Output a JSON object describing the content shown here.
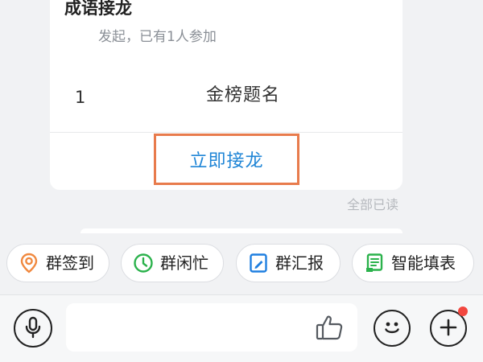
{
  "card": {
    "title": "成语接龙",
    "subtitle": "发起，已有1人参加",
    "entries": [
      {
        "index": "1",
        "text": "金榜题名"
      }
    ],
    "join_label": "立即接龙"
  },
  "read_status": "全部已读",
  "quick_actions": [
    {
      "label": "群签到",
      "icon": "location-pin-icon",
      "color": "#f0883e"
    },
    {
      "label": "群闲忙",
      "icon": "clock-icon",
      "color": "#2bb24c"
    },
    {
      "label": "群汇报",
      "icon": "report-edit-icon",
      "color": "#1f7fe0"
    },
    {
      "label": "智能填表",
      "icon": "form-table-icon",
      "color": "#2bb24c"
    }
  ],
  "input_bar": {
    "icons": [
      "microphone-icon",
      "thumbs-up-icon",
      "emoji-icon",
      "plus-icon"
    ],
    "badge_color": "#f2473f"
  },
  "colors": {
    "accent_blue": "#1f85d6",
    "highlight_orange": "#e87b4c"
  }
}
